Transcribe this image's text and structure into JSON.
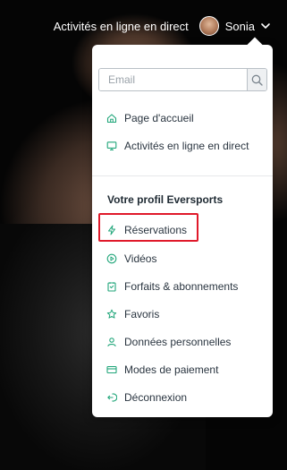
{
  "topbar": {
    "live_link": "Activités en ligne en direct",
    "user_name": "Sonia"
  },
  "menu": {
    "search": {
      "placeholder": "Email"
    },
    "nav_items": [
      {
        "label": "Page d'accueil",
        "icon": "home-icon"
      },
      {
        "label": "Activités en ligne en direct",
        "icon": "monitor-icon"
      }
    ],
    "profile_title": "Votre profil Eversports",
    "profile_items": [
      {
        "label": "Réservations",
        "icon": "lightning-icon"
      },
      {
        "label": "Vidéos",
        "icon": "play-icon"
      },
      {
        "label": "Forfaits & abonnements",
        "icon": "pass-icon"
      },
      {
        "label": "Favoris",
        "icon": "star-icon"
      },
      {
        "label": "Données personnelles",
        "icon": "person-icon"
      },
      {
        "label": "Modes de paiement",
        "icon": "card-icon"
      },
      {
        "label": "Déconnexion",
        "icon": "logout-icon"
      }
    ]
  },
  "colors": {
    "accent": "#21a67a",
    "highlight_box": "#e0192a",
    "menu_text": "#2a3540"
  }
}
